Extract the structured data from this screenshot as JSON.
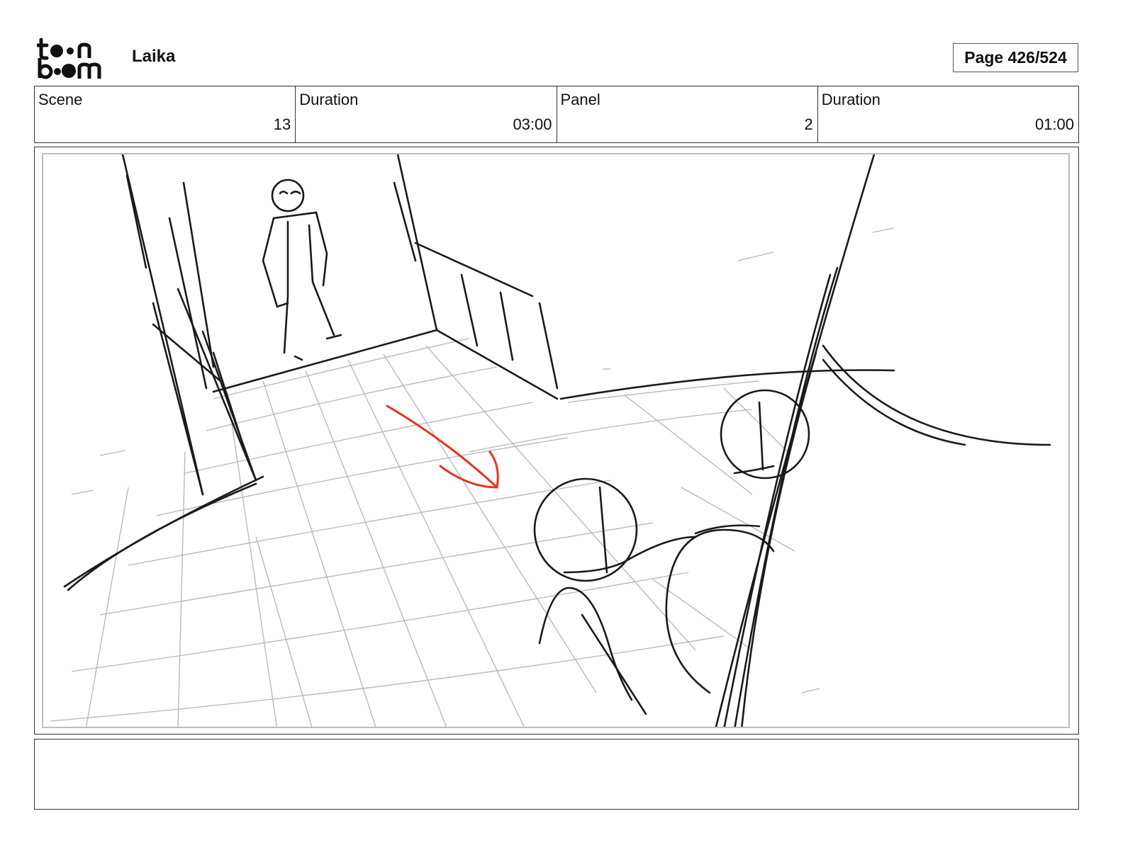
{
  "header": {
    "logo_text_line1": "toon",
    "logo_text_line2": "boom",
    "project_title": "Laika",
    "page_label": "Page 426/524"
  },
  "info": {
    "scene_label": "Scene",
    "scene_value": "13",
    "scene_duration_label": "Duration",
    "scene_duration_value": "03:00",
    "panel_label": "Panel",
    "panel_value": "2",
    "panel_duration_label": "Duration",
    "panel_duration_value": "01:00"
  },
  "sketch": {
    "ink_color": "#1a1a1a",
    "grid_color": "#b5b5b5",
    "arrow_color": "#e8321e"
  },
  "notes": {
    "text": ""
  }
}
